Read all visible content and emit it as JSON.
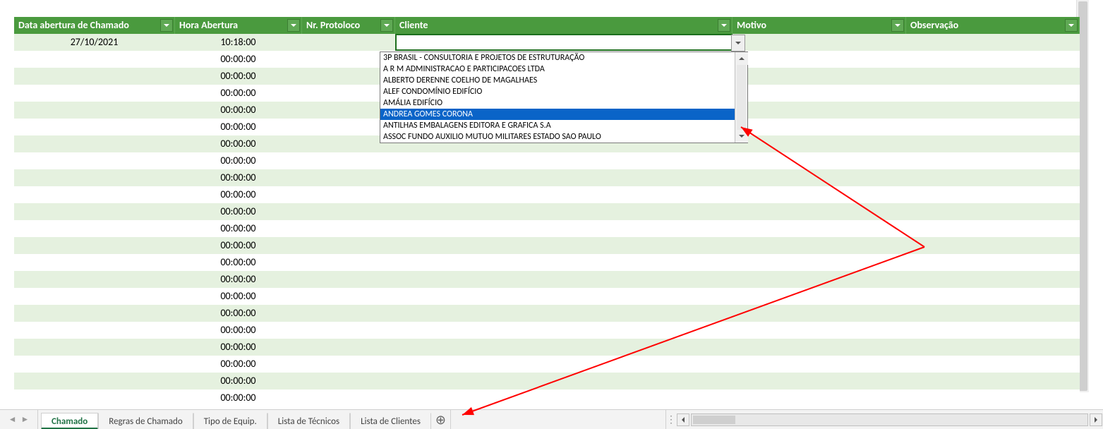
{
  "columns": {
    "data_abertura": "Data abertura de Chamado",
    "hora_abertura": "Hora Abertura",
    "nr_protoloco": "Nr. Protoloco",
    "cliente": "Cliente",
    "motivo": "Motivo",
    "observacao": "Observação"
  },
  "rows": [
    {
      "data": "27/10/2021",
      "hora": "10:18:00",
      "proto": "",
      "cliente": "",
      "motivo": "",
      "obs": ""
    },
    {
      "data": "",
      "hora": "00:00:00",
      "proto": "",
      "cliente": "",
      "motivo": "",
      "obs": ""
    },
    {
      "data": "",
      "hora": "00:00:00",
      "proto": "",
      "cliente": "",
      "motivo": "",
      "obs": ""
    },
    {
      "data": "",
      "hora": "00:00:00",
      "proto": "",
      "cliente": "",
      "motivo": "",
      "obs": ""
    },
    {
      "data": "",
      "hora": "00:00:00",
      "proto": "",
      "cliente": "",
      "motivo": "",
      "obs": ""
    },
    {
      "data": "",
      "hora": "00:00:00",
      "proto": "",
      "cliente": "",
      "motivo": "",
      "obs": ""
    },
    {
      "data": "",
      "hora": "00:00:00",
      "proto": "",
      "cliente": "",
      "motivo": "",
      "obs": ""
    },
    {
      "data": "",
      "hora": "00:00:00",
      "proto": "",
      "cliente": "",
      "motivo": "",
      "obs": ""
    },
    {
      "data": "",
      "hora": "00:00:00",
      "proto": "",
      "cliente": "",
      "motivo": "",
      "obs": ""
    },
    {
      "data": "",
      "hora": "00:00:00",
      "proto": "",
      "cliente": "",
      "motivo": "",
      "obs": ""
    },
    {
      "data": "",
      "hora": "00:00:00",
      "proto": "",
      "cliente": "",
      "motivo": "",
      "obs": ""
    },
    {
      "data": "",
      "hora": "00:00:00",
      "proto": "",
      "cliente": "",
      "motivo": "",
      "obs": ""
    },
    {
      "data": "",
      "hora": "00:00:00",
      "proto": "",
      "cliente": "",
      "motivo": "",
      "obs": ""
    },
    {
      "data": "",
      "hora": "00:00:00",
      "proto": "",
      "cliente": "",
      "motivo": "",
      "obs": ""
    },
    {
      "data": "",
      "hora": "00:00:00",
      "proto": "",
      "cliente": "",
      "motivo": "",
      "obs": ""
    },
    {
      "data": "",
      "hora": "00:00:00",
      "proto": "",
      "cliente": "",
      "motivo": "",
      "obs": ""
    },
    {
      "data": "",
      "hora": "00:00:00",
      "proto": "",
      "cliente": "",
      "motivo": "",
      "obs": ""
    },
    {
      "data": "",
      "hora": "00:00:00",
      "proto": "",
      "cliente": "",
      "motivo": "",
      "obs": ""
    },
    {
      "data": "",
      "hora": "00:00:00",
      "proto": "",
      "cliente": "",
      "motivo": "",
      "obs": ""
    },
    {
      "data": "",
      "hora": "00:00:00",
      "proto": "",
      "cliente": "",
      "motivo": "",
      "obs": ""
    },
    {
      "data": "",
      "hora": "00:00:00",
      "proto": "",
      "cliente": "",
      "motivo": "",
      "obs": ""
    },
    {
      "data": "",
      "hora": "00:00:00",
      "proto": "",
      "cliente": "",
      "motivo": "",
      "obs": ""
    }
  ],
  "dropdown": {
    "items": [
      "3P BRASIL - CONSULTORIA E PROJETOS DE ESTRUTURAÇÃO",
      "A R M ADMINISTRACAO E PARTICIPACOES LTDA",
      "ALBERTO DERENNE COELHO DE MAGALHAES",
      "ALEF CONDOMÍNIO EDIFÍCIO",
      "AMÁLIA EDIFÍCIO",
      "ANDREA GOMES CORONA",
      "ANTILHAS EMBALAGENS EDITORA E GRAFICA S.A",
      "ASSOC FUNDO AUXILIO MUTUO MILITARES ESTADO SAO PAULO"
    ],
    "selected_index": 5
  },
  "tabs": {
    "items": [
      "Chamado",
      "Regras de Chamado",
      "Tipo de Equip.",
      "Lista de Técnicos",
      "Lista de Clientes"
    ],
    "active_index": 0
  }
}
